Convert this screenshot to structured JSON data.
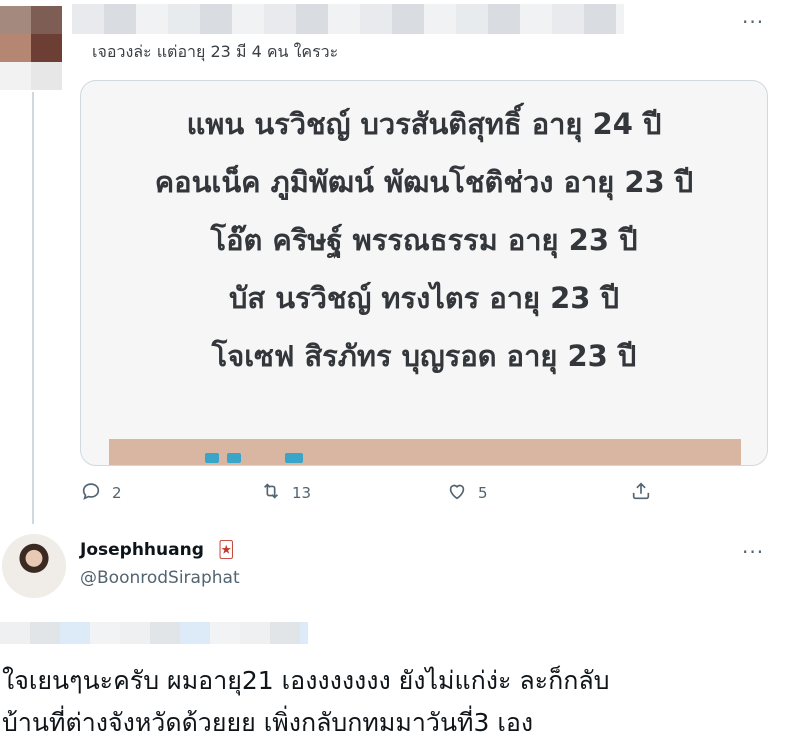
{
  "tweet1": {
    "reply_text": "เจอวงล่ะ แต่อายุ 23 มี 4 คน ใครวะ",
    "media_lines": [
      "แพน นรวิชญ์ บวรสันติสุทธิ์ อายุ 24 ปี",
      "คอนเน็ค ภูมิพัฒน์ พัฒนโชติช่วง อายุ 23 ปี",
      "โอ๊ต คริษฐ์ พรรณธรรม อายุ 23 ปี",
      "บัส นรวิชญ์ ทรงไตร อายุ 23 ปี",
      "โจเซฟ สิรภัทร บุญรอด อายุ 23 ปี"
    ],
    "replies": "2",
    "retweets": "13",
    "likes": "5",
    "more": "···"
  },
  "tweet2": {
    "name": "Josephhuang",
    "badge_emoji": "🃏",
    "handle": "@BoonrodSiraphat",
    "more": "···",
    "body_line1": "ใจเยนๆนะครับ ผมอายุ21 เองงงงงงง ยังไม่แก่ง่ะ ละก็กลับ",
    "body_line2": "บ้านที่ต่างจังหวัดด้วยยย เพิ่งกลับกทมมาวันที่3 เอง"
  },
  "icons": {
    "reply": "comment-icon",
    "retweet": "retweet-icon",
    "like": "heart-icon",
    "share": "share-icon"
  },
  "colors": {
    "text": "#0f1419",
    "muted": "#536471",
    "border": "#cfd9de"
  }
}
